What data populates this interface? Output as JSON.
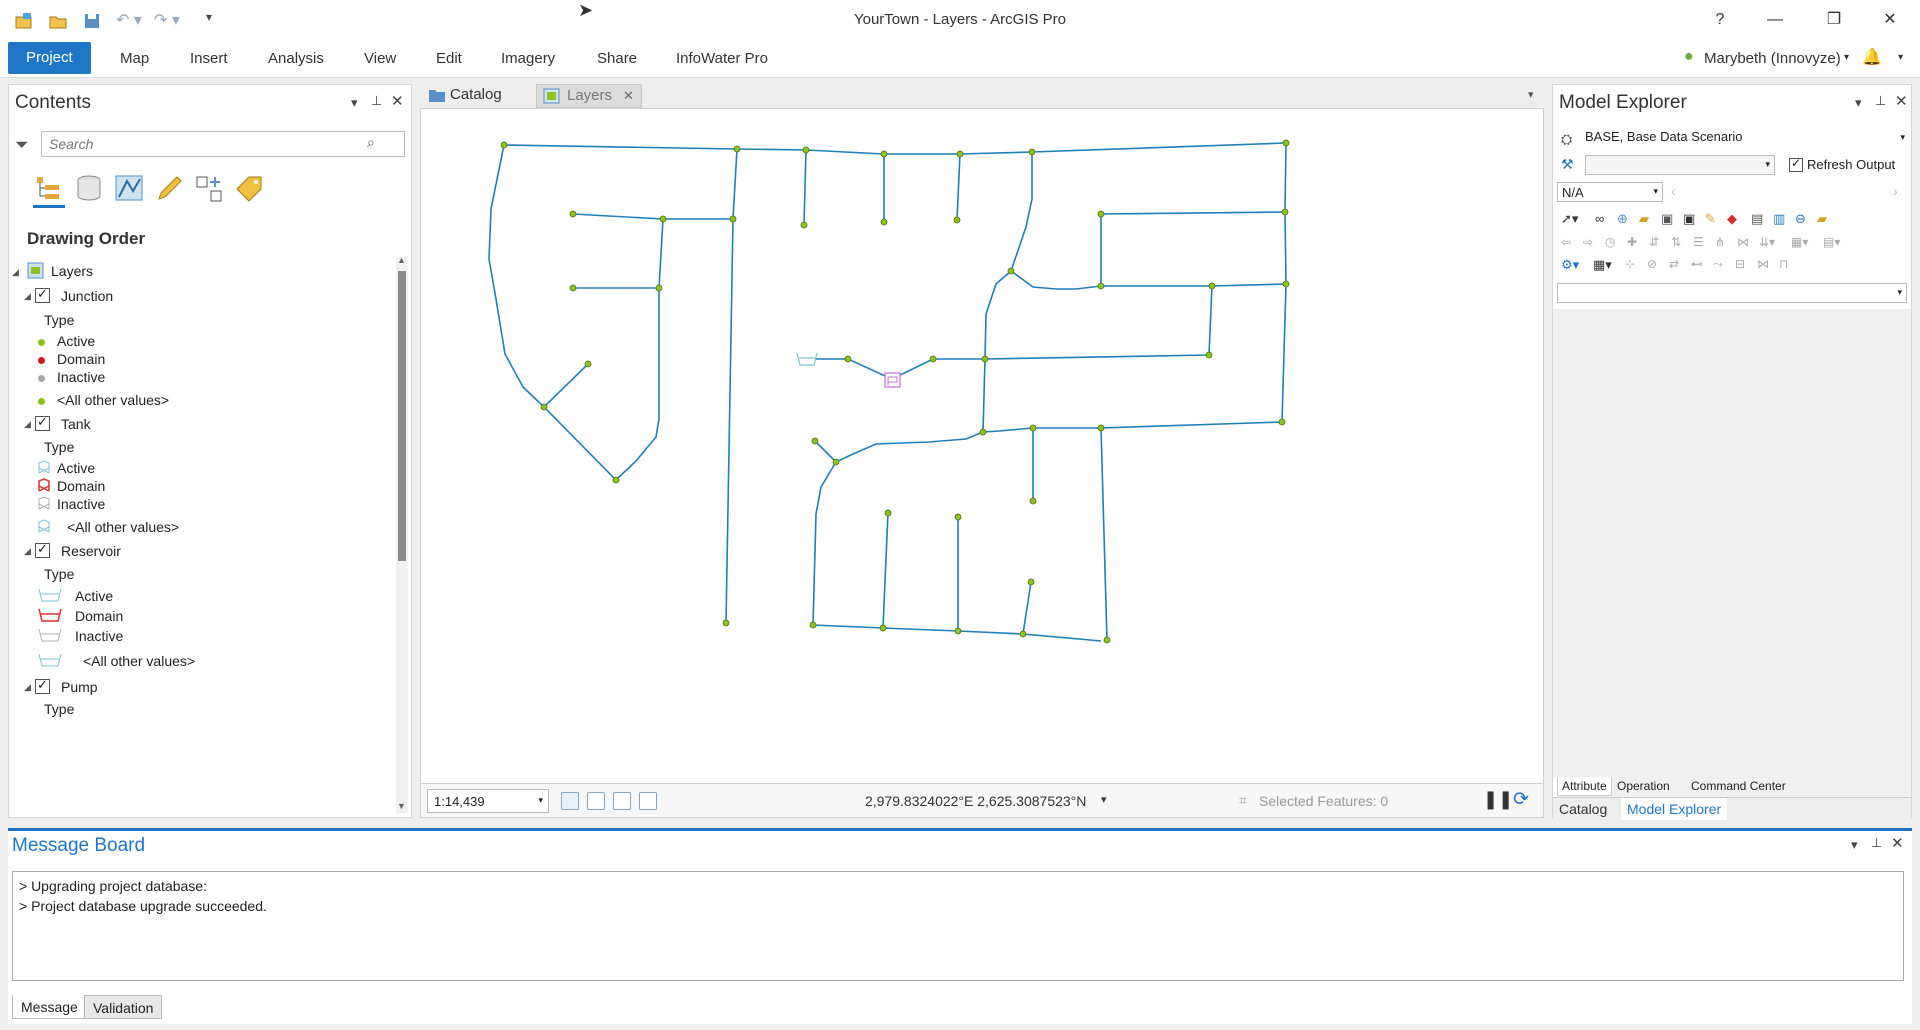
{
  "window": {
    "title": "YourTown - Layers - ArcGIS Pro",
    "help": "?",
    "minimize": "—",
    "restore": "❐",
    "close": "✕"
  },
  "ribbon": {
    "tabs": [
      "Project",
      "Map",
      "Insert",
      "Analysis",
      "View",
      "Edit",
      "Imagery",
      "Share",
      "InfoWater Pro"
    ],
    "user": "Marybeth (Innovyze)"
  },
  "contents": {
    "title": "Contents",
    "search_placeholder": "Search",
    "section": "Drawing Order",
    "root": "Layers",
    "layers": [
      {
        "name": "Junction",
        "type_label": "Type",
        "items": [
          "Active",
          "Domain",
          "Inactive",
          "<All other values>"
        ]
      },
      {
        "name": "Tank",
        "type_label": "Type",
        "items": [
          "Active",
          "Domain",
          "Inactive",
          "<All other values>"
        ]
      },
      {
        "name": "Reservoir",
        "type_label": "Type",
        "items": [
          "Active",
          "Domain",
          "Inactive",
          "<All other values>"
        ]
      },
      {
        "name": "Pump",
        "type_label": "Type"
      }
    ],
    "colors": {
      "active": "#8fc320",
      "domain": "#d01818",
      "inactive": "#a8a8a8",
      "tank_active": "#7fc6d0",
      "tank_domain": "#e03030"
    }
  },
  "map_tabs": {
    "catalog": "Catalog",
    "layers": "Layers"
  },
  "map_status": {
    "scale": "1:14,439",
    "coords": "2,979.8324022°E 2,625.3087523°N",
    "selected": "Selected Features: 0"
  },
  "model_explorer": {
    "title": "Model Explorer",
    "scenario": "BASE, Base Data Scenario",
    "refresh_output": "Refresh Output",
    "na_value": "N/A",
    "bottom_tabs": [
      "Attribute",
      "Operation",
      "Command Center"
    ],
    "panel_tabs": [
      "Catalog",
      "Model Explorer"
    ]
  },
  "message_board": {
    "title": "Message Board",
    "lines": [
      "> Upgrading project database:",
      "> Project database upgrade succeeded."
    ],
    "tabs": [
      "Message",
      "Validation"
    ]
  },
  "colors": {
    "accent": "#1f76c8",
    "pipe": "#1f7fb8",
    "node": "#8fc320"
  }
}
